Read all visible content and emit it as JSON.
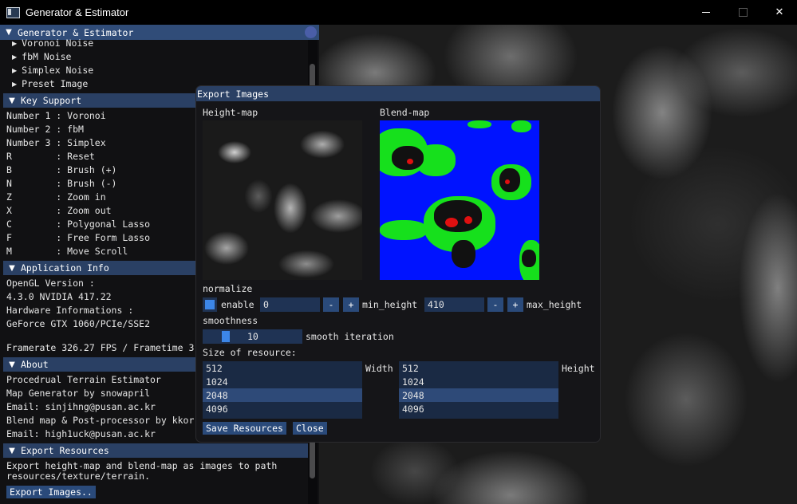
{
  "window": {
    "title": "Generator & Estimator"
  },
  "panel": {
    "title": "Generator & Estimator",
    "noise_items": [
      "Voronoi Noise",
      "fbM Noise",
      "Simplex Noise",
      "Preset Image"
    ],
    "key_support": {
      "header": "Key Support",
      "rows": [
        "Number 1 : Voronoi",
        "Number 2 : fbM",
        "Number 3 : Simplex",
        "R        : Reset",
        "B        : Brush (+)",
        "N        : Brush (-)",
        "Z        : Zoom in",
        "X        : Zoom out",
        "C        : Polygonal Lasso",
        "F        : Free Form Lasso",
        "M        : Move Scroll"
      ]
    },
    "app_info": {
      "header": "Application Info",
      "opengl_label": "OpenGL Version :",
      "opengl_value": "4.3.0 NVIDIA 417.22",
      "hw_label": "Hardware Informations :",
      "hw_value": "GeForce GTX 1060/PCIe/SSE2",
      "framerate": "Framerate 326.27 FPS / Frametime 3"
    },
    "about": {
      "header": "About",
      "lines": [
        "Procedrual Terrain Estimator",
        "Map Generator by snowapril",
        "Email: sinjihng@pusan.ac.kr",
        "Blend map & Post-processor by kkor",
        "Email: high1uck@pusan.ac.kr"
      ]
    },
    "export": {
      "header": "Export Resources",
      "desc1": "Export height-map and blend-map as images to path",
      "desc2": "resources/texture/terrain.",
      "button": "Export Images.."
    }
  },
  "modal": {
    "title": "Export Images",
    "heightmap_label": "Height-map",
    "blendmap_label": "Blend-map",
    "normalize_label": "normalize",
    "enable_label": "enable",
    "enabled": true,
    "min_height_value": "0",
    "min_height_label": "min_height",
    "max_height_value": "410",
    "max_height_label": "max_height",
    "minus": "-",
    "plus": "+",
    "smoothness_label": "smoothness",
    "smooth_value": "10",
    "smooth_label": "smooth iteration",
    "size_label": "Size of resource:",
    "width_label": "Width",
    "height_label": "Height",
    "sizes": [
      "512",
      "1024",
      "2048",
      "4096"
    ],
    "selected_width": "2048",
    "selected_height": "2048",
    "save_button": "Save Resources",
    "close_button": "Close"
  },
  "colors": {
    "header_bg": "#2a4064",
    "button_bg": "#2a4a7a",
    "checkbox_mark": "#3c86e8",
    "blend_blue": "#0013ff",
    "blend_green": "#16e01c",
    "blend_red": "#e01010"
  }
}
